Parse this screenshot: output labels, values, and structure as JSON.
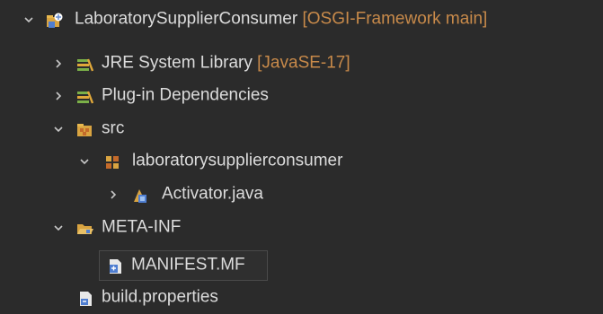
{
  "project": {
    "name": "LaboratorySupplierConsumer",
    "decoration": "[OSGI-Framework main]"
  },
  "jre": {
    "name": "JRE System Library",
    "decoration": "[JavaSE-17]"
  },
  "plugin_deps": {
    "name": "Plug-in Dependencies"
  },
  "src": {
    "name": "src"
  },
  "package": {
    "name": "laboratorysupplierconsumer"
  },
  "activator": {
    "name": "Activator.java"
  },
  "meta_inf": {
    "name": "META-INF"
  },
  "manifest": {
    "name": "MANIFEST.MF"
  },
  "build_props": {
    "name": "build.properties"
  },
  "colors": {
    "background": "#2b2b2b",
    "text": "#dcdcdc",
    "decoration": "#c88a4a"
  }
}
